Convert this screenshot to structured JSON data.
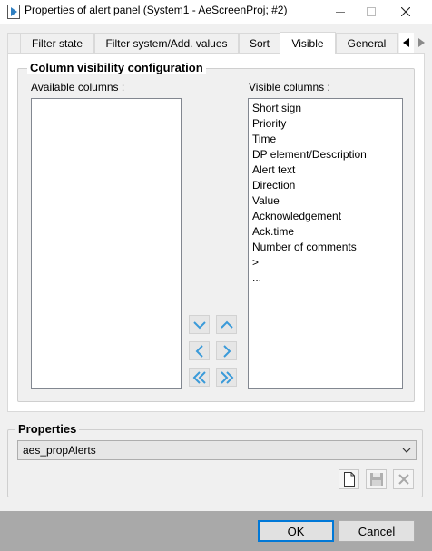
{
  "window": {
    "title": "Properties of alert panel (System1 - AeScreenProj; #2)"
  },
  "tabs": [
    {
      "label": "Filter state"
    },
    {
      "label": "Filter system/Add. values"
    },
    {
      "label": "Sort"
    },
    {
      "label": "Visible",
      "active": true
    },
    {
      "label": "General"
    }
  ],
  "visibility": {
    "group_title": "Column visibility configuration",
    "available_label": "Available columns :",
    "visible_label": "Visible columns :",
    "available_columns": [],
    "visible_columns": [
      "Short sign",
      "Priority",
      "Time",
      "DP element/Description",
      "Alert text",
      "Direction",
      "Value",
      "Acknowledgement",
      "Ack.time",
      "Number of comments",
      ">",
      "..."
    ]
  },
  "properties": {
    "group_title": "Properties",
    "selected": "aes_propAlerts"
  },
  "buttons": {
    "ok": "OK",
    "cancel": "Cancel"
  },
  "colors": {
    "arrow_icon": "#3a9ad9",
    "footer": "#a9a9a9"
  }
}
